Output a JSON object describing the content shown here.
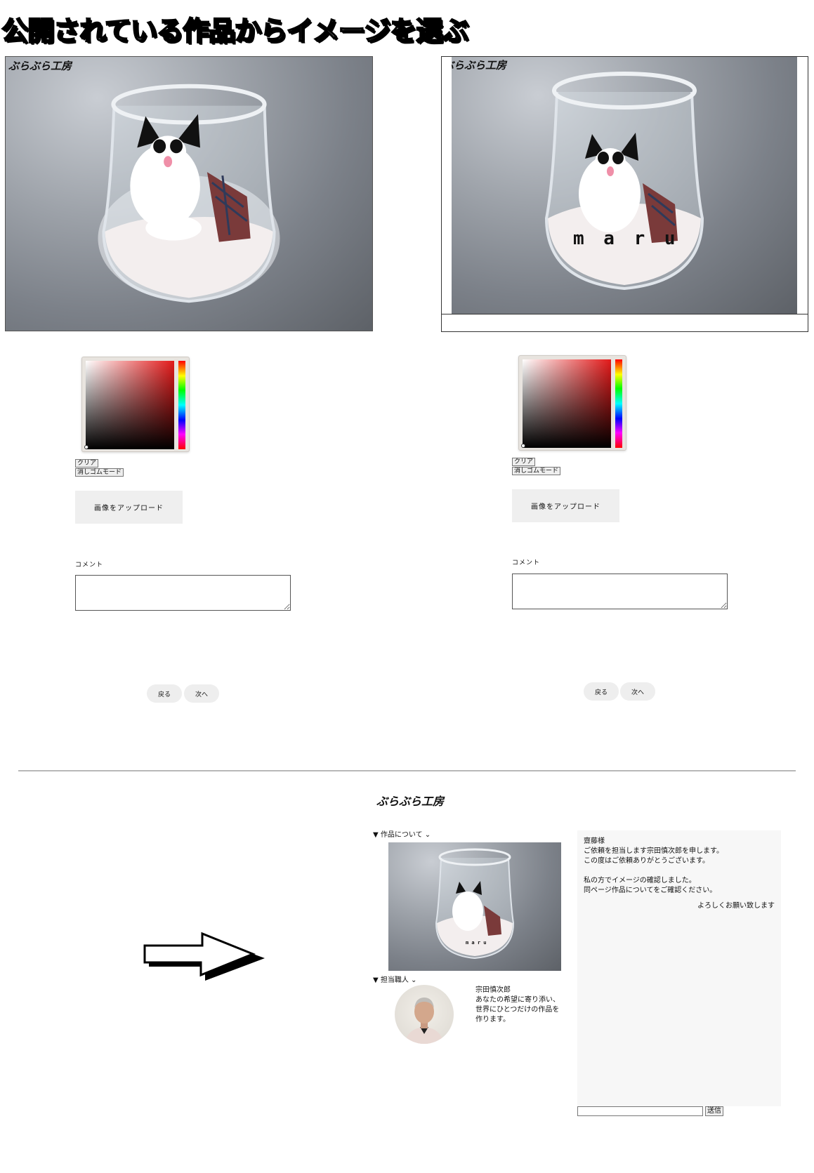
{
  "heading": "公開されている作品からイメージを選ぶ",
  "brand": "ぶらぶら工房",
  "left_panel": {
    "clear_label": "クリア",
    "eraser_label": "消しゴムモード",
    "upload_label": "画像をアップロード",
    "comment_label": "コメント",
    "back_label": "戻る",
    "next_label": "次へ"
  },
  "right_panel": {
    "engraved_text": "m a r u",
    "clear_label": "クリア",
    "eraser_label": "消しゴムモード",
    "upload_label": "画像をアップロード",
    "comment_label": "コメント",
    "back_label": "戻る",
    "next_label": "次へ"
  },
  "result": {
    "about_summary": "▼ 作品について ⌄",
    "craftsman_summary": "▼ 担当職人 ⌄",
    "thumbnail_text": "m a r u",
    "craftsman_name": "宗田慎次郎",
    "craftsman_bio": "あなたの希望に寄り添い、世界にひとつだけの作品を作ります。",
    "message": {
      "salutation": "齋藤様",
      "line1": "ご依頼を担当します宗田慎次郎を申します。",
      "line2": "この度はご依頼ありがとうございます。",
      "line3": "私の方でイメージの確認しました。",
      "line4": "同ページ作品についてをご確認ください。",
      "closing": "よろしくお願い致します"
    },
    "send_label": "送信"
  }
}
